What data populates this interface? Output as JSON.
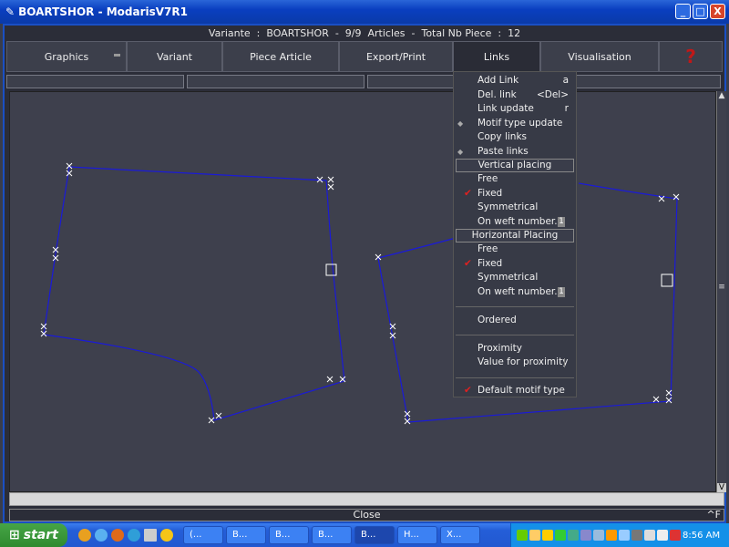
{
  "window": {
    "title": "BOARTSHOR - ModarisV7R1",
    "minimize": "_",
    "maximize": "□",
    "close": "X"
  },
  "info_line": "Variante  :  BOARTSHOR  -  9/9  Articles  -  Total Nb Piece  :  12",
  "tabs": [
    {
      "label": "Graphics"
    },
    {
      "label": "Variant"
    },
    {
      "label": "Piece Article"
    },
    {
      "label": "Export/Print"
    },
    {
      "label": "Links",
      "active": true
    },
    {
      "label": "Visualisation"
    },
    {
      "label": "?"
    }
  ],
  "links_menu": {
    "items": [
      {
        "label": "Add Link",
        "shortcut": "a"
      },
      {
        "label": "Del. link",
        "shortcut": "<Del>"
      },
      {
        "label": "Link update",
        "shortcut": "r"
      },
      {
        "label": "Motif type update",
        "submenu_marker": true
      },
      {
        "label": "Copy links"
      },
      {
        "label": "Paste links",
        "submenu_marker": true
      }
    ],
    "vertical_header": "Vertical placing",
    "vertical": [
      {
        "label": "Free"
      },
      {
        "label": "Fixed",
        "checked": true
      },
      {
        "label": "Symmetrical"
      },
      {
        "label": "On weft number...",
        "value": "1"
      }
    ],
    "horizontal_header": "Horizontal Placing",
    "horizontal": [
      {
        "label": "Free"
      },
      {
        "label": "Fixed",
        "checked": true
      },
      {
        "label": "Symmetrical"
      },
      {
        "label": "On weft number...",
        "value": "1"
      }
    ],
    "ordered": "Ordered",
    "proximity": "Proximity",
    "value_for_proximity": "Value for proximity",
    "default_motif": {
      "label": "Default motif type",
      "checked": true
    }
  },
  "scroll": {
    "up": "▲",
    "down": "V",
    "thumb": "≡"
  },
  "close_bar": {
    "label": "Close",
    "shortcut": "^F"
  },
  "taskbar": {
    "start": "start",
    "buttons": [
      "(...",
      "B...",
      "B...",
      "B...",
      "B...",
      "H...",
      "X..."
    ],
    "active_index": 4,
    "clock": "8:56 AM"
  },
  "colors": {
    "piece_outline": "#1a1ad8",
    "check": "#e02020",
    "help": "#c01818"
  }
}
